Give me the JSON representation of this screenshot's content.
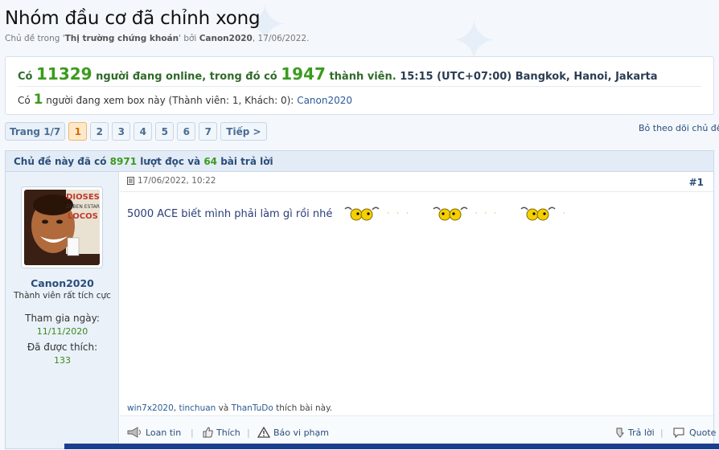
{
  "thread": {
    "title": "Nhóm đầu cơ đã chỉnh xong",
    "subtitle_prefix": "Chủ đề trong '",
    "forum": "Thị trường chứng khoán",
    "subtitle_mid": "' bởi ",
    "author": "Canon2020",
    "subtitle_date": ", 17/06/2022."
  },
  "online": {
    "prefix": "Có",
    "online_count": "11329",
    "mid": "người đang online, trong đó có",
    "member_count": "1947",
    "suffix": "thành viên.",
    "timezone": "15:15 (UTC+07:00) Bangkok, Hanoi, Jakarta",
    "viewing_prefix": "Có",
    "viewing_count": "1",
    "viewing_text": "người đang xem box này (Thành viên: 1, Khách: 0):",
    "viewing_user": "Canon2020"
  },
  "pagination": {
    "label": "Trang 1/7",
    "pages": [
      "1",
      "2",
      "3",
      "4",
      "5",
      "6",
      "7"
    ],
    "current": "1",
    "next": "Tiếp >",
    "unwatch": "Bỏ theo dõi chủ đề"
  },
  "thread_stats": {
    "prefix": "Chủ đề này đã có",
    "views": "8971",
    "mid": "lượt đọc và",
    "replies": "64",
    "suffix": "bài trả lời"
  },
  "post": {
    "date": "17/06/2022, 10:22",
    "number": "#1",
    "message": "5000 ACE biết mình phải làm gì rồi nhé",
    "user": {
      "name": "Canon2020",
      "title": "Thành viên rất tích cực",
      "avatar_text": [
        "DIOSES",
        "DEBEN ESTAR",
        "LOCOS"
      ],
      "joined_label": "Tham gia ngày:",
      "joined_value": "11/11/2020",
      "liked_label": "Đã được thích:",
      "liked_value": "133"
    },
    "likes": {
      "users": [
        "win7x2020",
        "tinchuan",
        "ThanTuDo"
      ],
      "sep": ", ",
      "and": " và ",
      "suffix": " thích bài này."
    },
    "actions": {
      "report_spread": "Loan tin",
      "like": "Thích",
      "report": "Báo vi phạm",
      "reply": "Trả lời",
      "quote": "Quote"
    }
  },
  "colors": {
    "accent_green": "#3a9b1d",
    "link_blue": "#2a5b94",
    "current_page": "#d66a0c"
  }
}
